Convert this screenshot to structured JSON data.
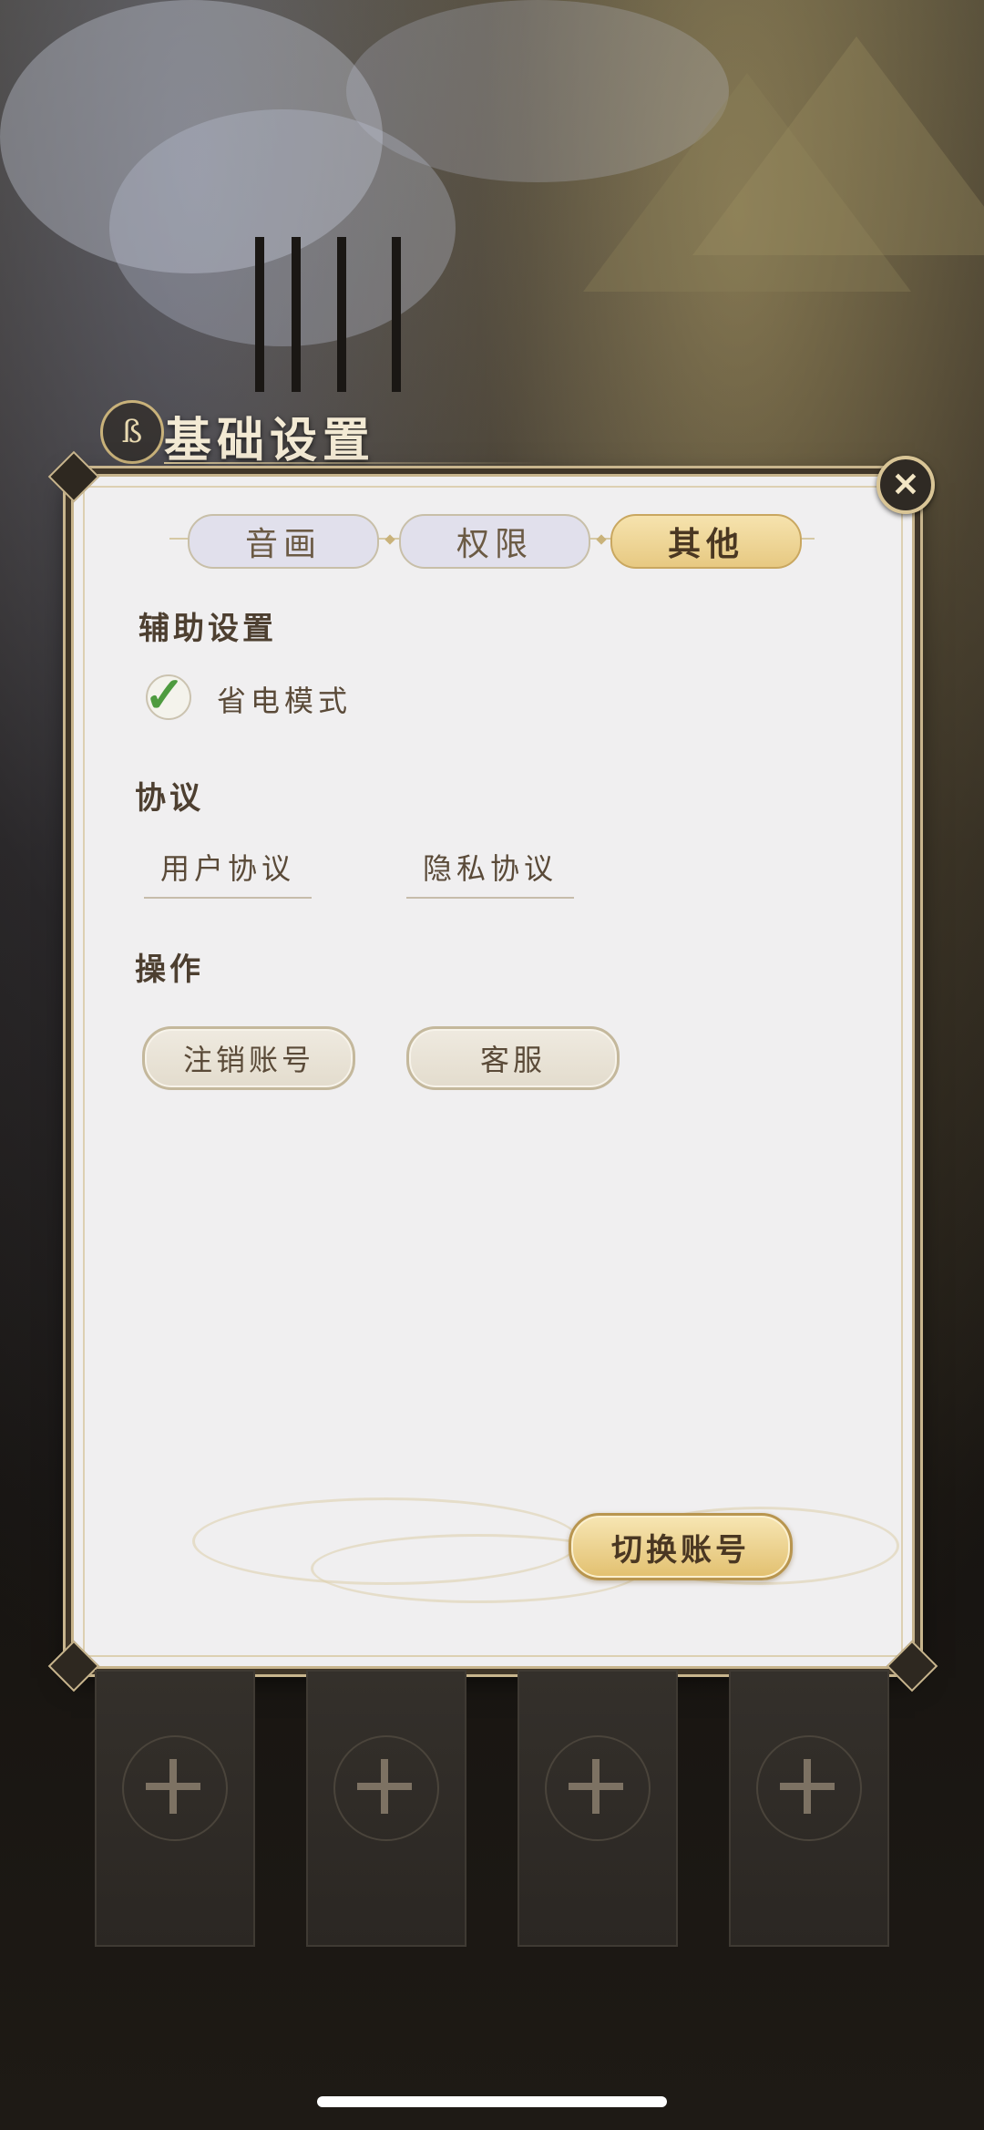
{
  "header": {
    "title": "基础设置",
    "emblem": "ß"
  },
  "close": {
    "icon": "close-x-icon",
    "glyph": "✕"
  },
  "tabs": [
    {
      "label": "音画",
      "active": false
    },
    {
      "label": "权限",
      "active": false
    },
    {
      "label": "其他",
      "active": true
    }
  ],
  "assist": {
    "title": "辅助设置",
    "power_saving": {
      "label": "省电模式",
      "checked": true,
      "glyph": "✓"
    }
  },
  "agreement": {
    "title": "协议",
    "links": [
      "用户协议",
      "隐私协议"
    ]
  },
  "operations": {
    "title": "操作",
    "buttons": [
      "注销账号",
      "客服"
    ]
  },
  "switch_account": {
    "label": "切换账号"
  },
  "slots": [
    {
      "icon": "plus-icon"
    },
    {
      "icon": "plus-icon"
    },
    {
      "icon": "plus-icon"
    },
    {
      "icon": "plus-icon"
    }
  ],
  "colors": {
    "panel": "#f0eff0",
    "accent_gold": "#e2c06f",
    "check_green": "#4e9b3f"
  }
}
